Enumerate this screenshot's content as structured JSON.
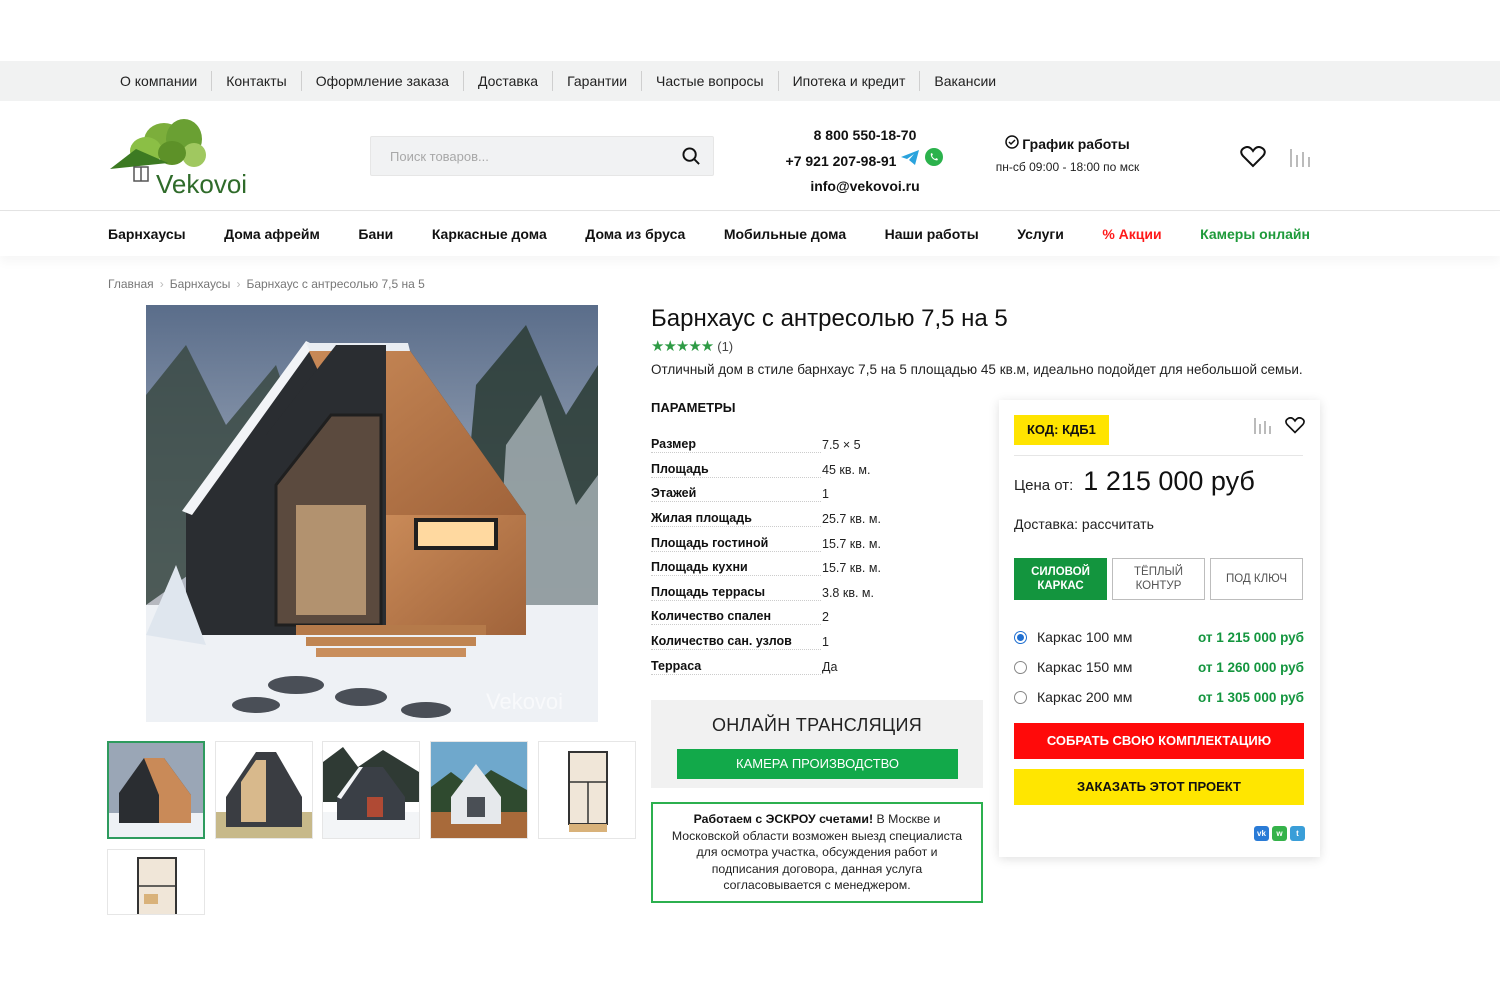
{
  "topbar": {
    "items": [
      "О компании",
      "Контакты",
      "Оформление заказа",
      "Доставка",
      "Гарантии",
      "Частые вопросы",
      "Ипотека и кредит",
      "Вакансии"
    ]
  },
  "header": {
    "logo_text": "Vekovoi",
    "search_placeholder": "Поиск товаров...",
    "phone1": "8 800 550-18-70",
    "phone2": "+7 921 207-98-91",
    "email": "info@vekovoi.ru",
    "schedule_title": "График работы",
    "schedule_hours": "пн-сб 09:00 - 18:00 по мск"
  },
  "nav": {
    "items": [
      "Барнхаусы",
      "Дома афрейм",
      "Бани",
      "Каркасные дома",
      "Дома из бруса",
      "Мобильные дома",
      "Наши работы",
      "Услуги",
      "% Акции",
      "Камеры онлайн"
    ],
    "colors": {
      "promo": "#ff1a1a",
      "cameras": "#1e9a3a"
    }
  },
  "breadcrumb": [
    "Главная",
    "Барнхаусы",
    "Барнхаус с антресолью 7,5 на 5"
  ],
  "product": {
    "title": "Барнхаус с антресолью 7,5 на 5",
    "rating_stars": "★★★★★",
    "rating_count": "(1)",
    "description": "Отличный дом в стиле барнхаус 7,5 на 5 площадью 45 кв.м, идеально подойдет для небольшой семьи.",
    "params_title": "ПАРАМЕТРЫ",
    "params": [
      {
        "k": "Размер",
        "v": "7.5 × 5"
      },
      {
        "k": "Площадь",
        "v": "45 кв. м."
      },
      {
        "k": "Этажей",
        "v": "1"
      },
      {
        "k": "Жилая площадь",
        "v": "25.7 кв. м."
      },
      {
        "k": "Площадь гостиной",
        "v": "15.7 кв. м."
      },
      {
        "k": "Площадь кухни",
        "v": "15.7 кв. м."
      },
      {
        "k": "Площадь террасы",
        "v": "3.8 кв. м."
      },
      {
        "k": "Количество спален",
        "v": "2"
      },
      {
        "k": "Количество сан. узлов",
        "v": "1"
      },
      {
        "k": "Терраса",
        "v": "Да"
      }
    ],
    "watermark": "Vekovoi"
  },
  "live": {
    "title": "ОНЛАЙН ТРАНСЛЯЦИЯ",
    "button": "КАМЕРА ПРОИЗВОДСТВО"
  },
  "escrow": {
    "bold": "Работаем с ЭСКРОУ счетами!",
    "text": " В Москве и Московской области возможен выезд специалиста для осмотра участка, обсуждения работ и подписания договора, данная услуга согласовывается с менеджером."
  },
  "card": {
    "code": "КОД: КДБ1",
    "price_label": "Цена от:",
    "price_value": "1 215 000 руб",
    "delivery": "Доставка: рассчитать",
    "variants": [
      "СИЛОВОЙ КАРКАС",
      "ТЁПЛЫЙ КОНТУР",
      "ПОД КЛЮЧ"
    ],
    "options": [
      {
        "label": "Каркас 100 мм",
        "price": "от 1 215 000 руб",
        "selected": true
      },
      {
        "label": "Каркас 150 мм",
        "price": "от 1 260 000 руб",
        "selected": false
      },
      {
        "label": "Каркас 200 мм",
        "price": "от 1 305 000 руб",
        "selected": false
      }
    ],
    "btn_build": "СОБРАТЬ СВОЮ КОМПЛЕКТАЦИЮ",
    "btn_order": "ЗАКАЗАТЬ ЭТОТ ПРОЕКТ",
    "share": [
      "vk-icon",
      "whatsapp-icon",
      "telegram-icon"
    ]
  }
}
